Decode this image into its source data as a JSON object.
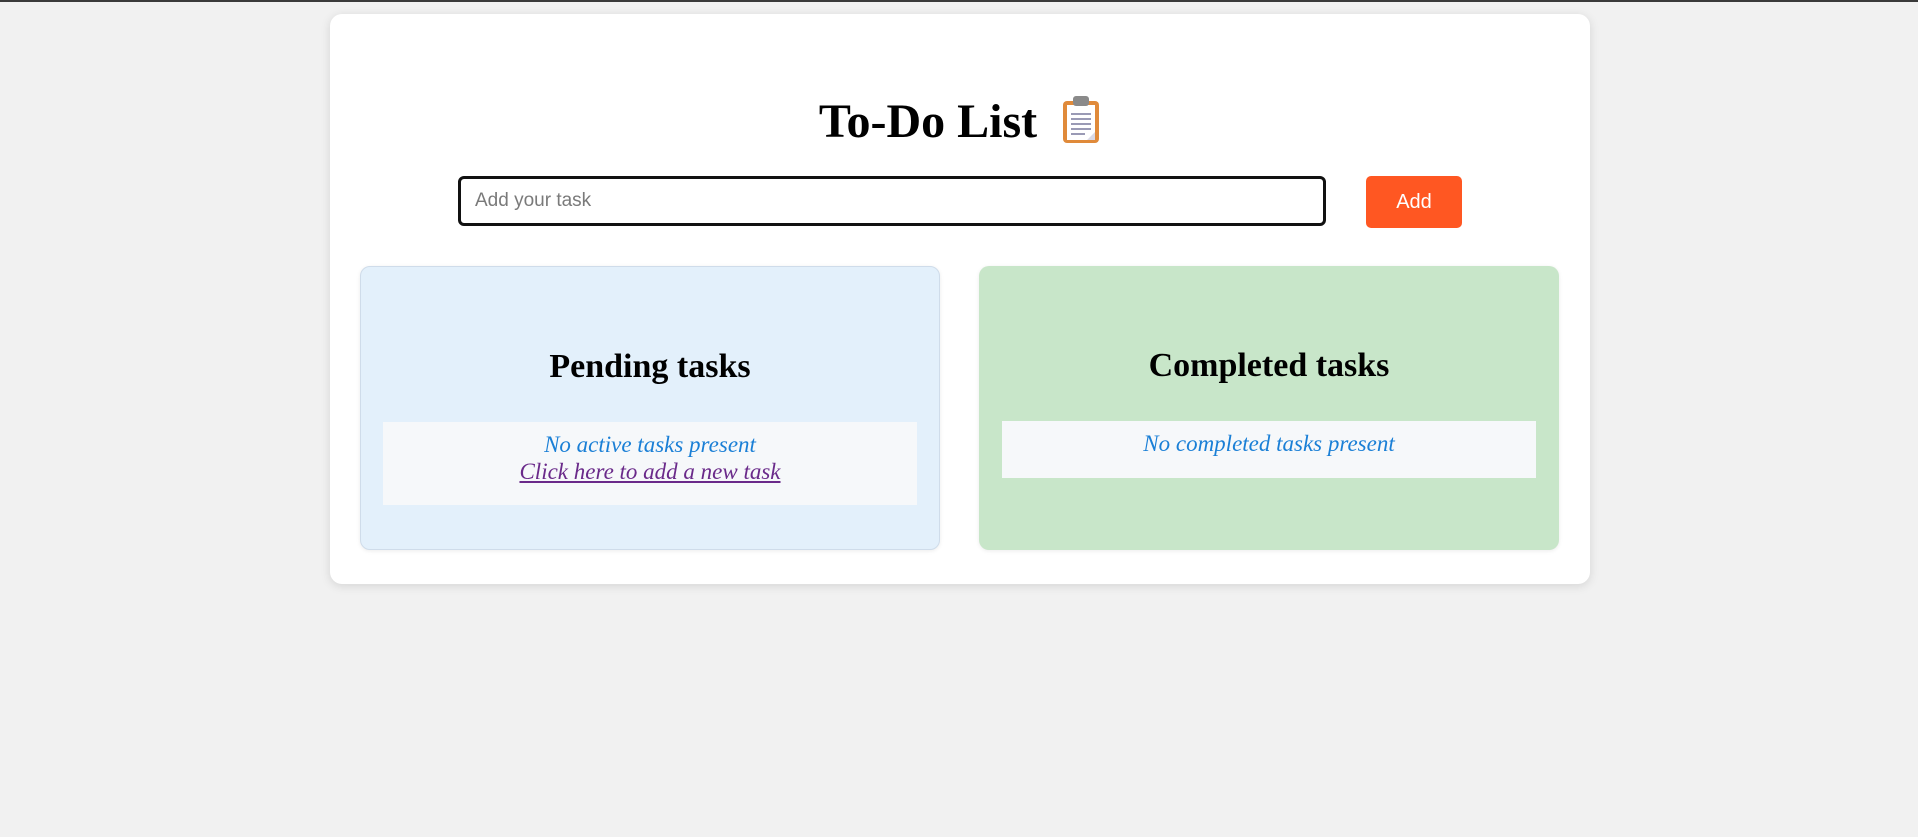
{
  "app": {
    "title": "To-Do List",
    "title_icon": "clipboard-icon"
  },
  "input": {
    "placeholder": "Add your task",
    "value": ""
  },
  "add_button": {
    "label": "Add"
  },
  "pending": {
    "heading": "Pending tasks",
    "empty_text": "No active tasks present",
    "add_link": "Click here to add a new task"
  },
  "completed": {
    "heading": "Completed tasks",
    "empty_text": "No completed tasks present"
  },
  "colors": {
    "accent": "#ff5722",
    "pending_bg": "#e3f0fb",
    "completed_bg": "#c8e6c9",
    "empty_text": "#1a7fd6",
    "link": "#6a2a8a"
  }
}
